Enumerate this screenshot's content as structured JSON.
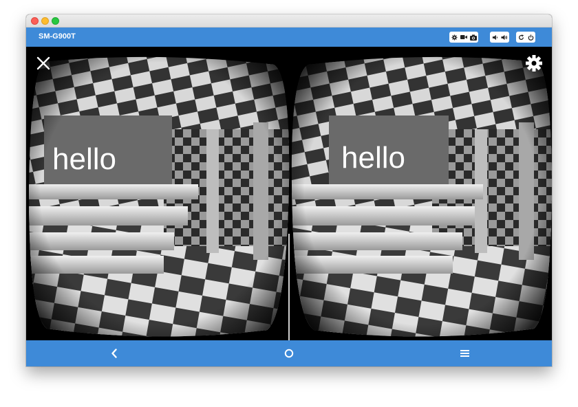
{
  "window": {
    "device_name": "SM-G900T"
  },
  "toolbar": {
    "buttons": [
      {
        "icon": "gear-icon"
      },
      {
        "icon": "video-camera-icon"
      },
      {
        "icon": "camera-icon"
      },
      {
        "icon": "volume-down-icon"
      },
      {
        "icon": "volume-up-icon"
      },
      {
        "icon": "rotate-icon"
      },
      {
        "icon": "power-icon"
      }
    ]
  },
  "vr_view": {
    "left_text": "hello",
    "right_text": "hello"
  },
  "navigation": {
    "back_icon": "chevron-left-icon",
    "home_icon": "circle-icon",
    "menu_icon": "menu-icon"
  },
  "colors": {
    "accent": "#3e8ad8",
    "background": "#000000"
  }
}
